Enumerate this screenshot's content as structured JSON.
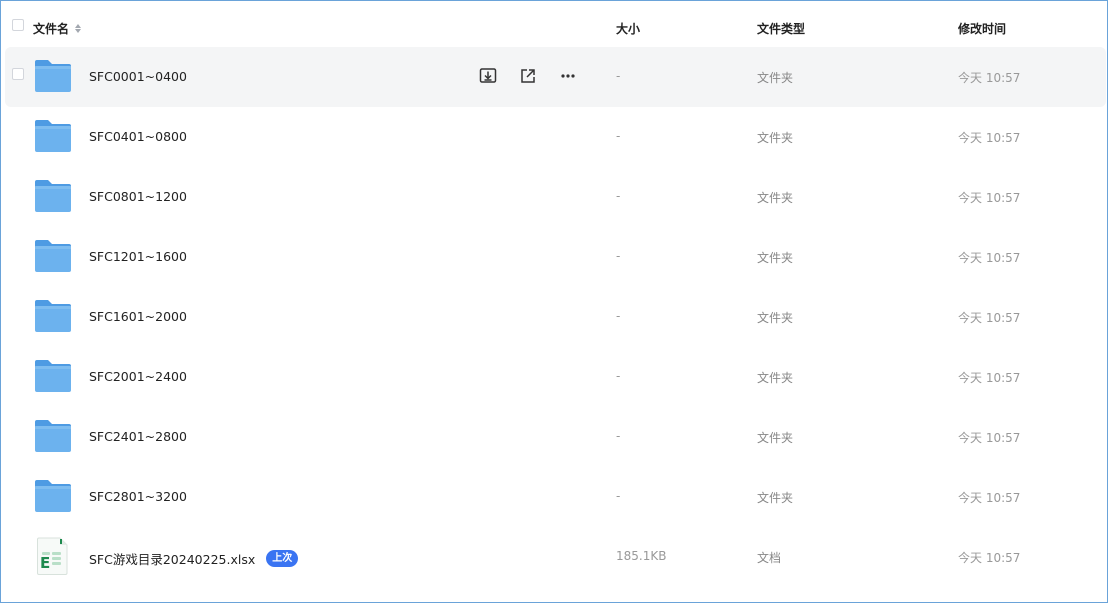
{
  "header": {
    "name_label": "文件名",
    "size_label": "大小",
    "type_label": "文件类型",
    "time_label": "修改时间"
  },
  "rows": [
    {
      "name": "SFC0001~0400",
      "size": "-",
      "type": "文件夹",
      "time": "今天 10:57",
      "icon": "folder-icon"
    },
    {
      "name": "SFC0401~0800",
      "size": "-",
      "type": "文件夹",
      "time": "今天 10:57",
      "icon": "folder-icon"
    },
    {
      "name": "SFC0801~1200",
      "size": "-",
      "type": "文件夹",
      "time": "今天 10:57",
      "icon": "folder-icon"
    },
    {
      "name": "SFC1201~1600",
      "size": "-",
      "type": "文件夹",
      "time": "今天 10:57",
      "icon": "folder-icon"
    },
    {
      "name": "SFC1601~2000",
      "size": "-",
      "type": "文件夹",
      "time": "今天 10:57",
      "icon": "folder-icon"
    },
    {
      "name": "SFC2001~2400",
      "size": "-",
      "type": "文件夹",
      "time": "今天 10:57",
      "icon": "folder-icon"
    },
    {
      "name": "SFC2401~2800",
      "size": "-",
      "type": "文件夹",
      "time": "今天 10:57",
      "icon": "folder-icon"
    },
    {
      "name": "SFC2801~3200",
      "size": "-",
      "type": "文件夹",
      "time": "今天 10:57",
      "icon": "folder-icon"
    },
    {
      "name": "SFC游戏目录20240225.xlsx",
      "size": "185.1KB",
      "type": "文档",
      "time": "今天 10:57",
      "icon": "excel-file-icon",
      "badge": "上次"
    }
  ],
  "colors": {
    "accent": "#3a74f2",
    "folder": "#5aa7ea",
    "excel": "#1e8a4e",
    "hover_row": "#f4f5f6"
  }
}
